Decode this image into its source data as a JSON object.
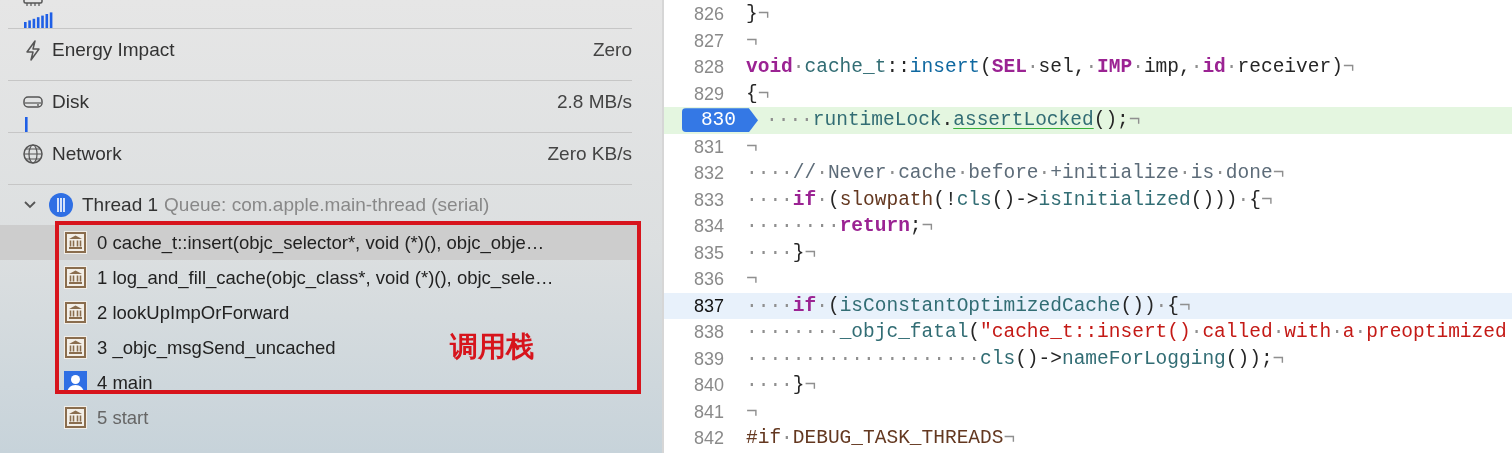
{
  "gauges": [
    {
      "kind": "memory",
      "graph": true
    },
    {
      "kind": "energy",
      "label": "Energy Impact",
      "value": "Zero"
    },
    {
      "kind": "disk",
      "label": "Disk",
      "value": "2.8 MB/s",
      "graph": true
    },
    {
      "kind": "network",
      "label": "Network",
      "value": "Zero KB/s"
    }
  ],
  "thread": {
    "expanded": true,
    "name": "Thread 1",
    "queue": "Queue: com.apple.main-thread (serial)"
  },
  "frames": [
    {
      "kind": "system",
      "text": "0 cache_t::insert(objc_selector*, void (*)(), objc_obje…",
      "selected": true,
      "dimmed": false
    },
    {
      "kind": "system",
      "text": "1 log_and_fill_cache(objc_class*, void (*)(), objc_sele…",
      "selected": false,
      "dimmed": false
    },
    {
      "kind": "system",
      "text": "2 lookUpImpOrForward",
      "selected": false,
      "dimmed": false
    },
    {
      "kind": "system",
      "text": "3 _objc_msgSend_uncached",
      "selected": false,
      "dimmed": false
    },
    {
      "kind": "user",
      "text": "4 main",
      "selected": false,
      "dimmed": false
    },
    {
      "kind": "system",
      "text": "5 start",
      "selected": false,
      "dimmed": true
    }
  ],
  "annotation": {
    "label": "调用栈"
  },
  "code_lines": [
    {
      "number": "826",
      "breakpoint": false,
      "executing": false,
      "current": false,
      "tokens": [
        {
          "kind": "plain",
          "text": "}"
        },
        {
          "kind": "ws",
          "text": "¬"
        }
      ]
    },
    {
      "number": "827",
      "breakpoint": false,
      "executing": false,
      "current": false,
      "tokens": [
        {
          "kind": "ws",
          "text": "¬"
        }
      ]
    },
    {
      "number": "828",
      "breakpoint": false,
      "executing": false,
      "current": false,
      "tokens": [
        {
          "kind": "keyword",
          "text": "void"
        },
        {
          "kind": "ws",
          "text": "·"
        },
        {
          "kind": "member",
          "text": "cache_t"
        },
        {
          "kind": "plain",
          "text": "::"
        },
        {
          "kind": "decl",
          "text": "insert"
        },
        {
          "kind": "plain",
          "text": "("
        },
        {
          "kind": "keyword",
          "text": "SEL"
        },
        {
          "kind": "ws",
          "text": "·"
        },
        {
          "kind": "plain",
          "text": "sel,"
        },
        {
          "kind": "ws",
          "text": "·"
        },
        {
          "kind": "keyword",
          "text": "IMP"
        },
        {
          "kind": "ws",
          "text": "·"
        },
        {
          "kind": "plain",
          "text": "imp,"
        },
        {
          "kind": "ws",
          "text": "·"
        },
        {
          "kind": "keyword",
          "text": "id"
        },
        {
          "kind": "ws",
          "text": "·"
        },
        {
          "kind": "plain",
          "text": "receiver)"
        },
        {
          "kind": "ws",
          "text": "¬"
        }
      ]
    },
    {
      "number": "829",
      "breakpoint": false,
      "executing": false,
      "current": false,
      "tokens": [
        {
          "kind": "plain",
          "text": "{"
        },
        {
          "kind": "ws",
          "text": "¬"
        }
      ]
    },
    {
      "number": "830",
      "breakpoint": true,
      "executing": true,
      "current": false,
      "tokens": [
        {
          "kind": "ws",
          "text": "····"
        },
        {
          "kind": "member",
          "text": "runtimeLock"
        },
        {
          "kind": "plain",
          "text": "."
        },
        {
          "kind": "link",
          "text": "assertLocked"
        },
        {
          "kind": "plain",
          "text": "();"
        },
        {
          "kind": "ws",
          "text": "¬"
        }
      ]
    },
    {
      "number": "831",
      "breakpoint": false,
      "executing": false,
      "current": false,
      "tokens": [
        {
          "kind": "ws",
          "text": "¬"
        }
      ]
    },
    {
      "number": "832",
      "breakpoint": false,
      "executing": false,
      "current": false,
      "tokens": [
        {
          "kind": "ws",
          "text": "····"
        },
        {
          "kind": "comment",
          "text": "//"
        },
        {
          "kind": "ws",
          "text": "·"
        },
        {
          "kind": "comment",
          "text": "Never"
        },
        {
          "kind": "ws",
          "text": "·"
        },
        {
          "kind": "comment",
          "text": "cache"
        },
        {
          "kind": "ws",
          "text": "·"
        },
        {
          "kind": "comment",
          "text": "before"
        },
        {
          "kind": "ws",
          "text": "·"
        },
        {
          "kind": "comment",
          "text": "+initialize"
        },
        {
          "kind": "ws",
          "text": "·"
        },
        {
          "kind": "comment",
          "text": "is"
        },
        {
          "kind": "ws",
          "text": "·"
        },
        {
          "kind": "comment",
          "text": "done"
        },
        {
          "kind": "ws",
          "text": "¬"
        }
      ]
    },
    {
      "number": "833",
      "breakpoint": false,
      "executing": false,
      "current": false,
      "tokens": [
        {
          "kind": "ws",
          "text": "····"
        },
        {
          "kind": "keyword",
          "text": "if"
        },
        {
          "kind": "ws",
          "text": "·"
        },
        {
          "kind": "plain",
          "text": "("
        },
        {
          "kind": "macro",
          "text": "slowpath"
        },
        {
          "kind": "plain",
          "text": "(!"
        },
        {
          "kind": "member",
          "text": "cls"
        },
        {
          "kind": "plain",
          "text": "()->"
        },
        {
          "kind": "member",
          "text": "isInitialized"
        },
        {
          "kind": "plain",
          "text": "()))"
        },
        {
          "kind": "ws",
          "text": "·"
        },
        {
          "kind": "plain",
          "text": "{"
        },
        {
          "kind": "ws",
          "text": "¬"
        }
      ]
    },
    {
      "number": "834",
      "breakpoint": false,
      "executing": false,
      "current": false,
      "tokens": [
        {
          "kind": "ws",
          "text": "········"
        },
        {
          "kind": "keyword",
          "text": "return"
        },
        {
          "kind": "plain",
          "text": ";"
        },
        {
          "kind": "ws",
          "text": "¬"
        }
      ]
    },
    {
      "number": "835",
      "breakpoint": false,
      "executing": false,
      "current": false,
      "tokens": [
        {
          "kind": "ws",
          "text": "····"
        },
        {
          "kind": "plain",
          "text": "}"
        },
        {
          "kind": "ws",
          "text": "¬"
        }
      ]
    },
    {
      "number": "836",
      "breakpoint": false,
      "executing": false,
      "current": false,
      "tokens": [
        {
          "kind": "ws",
          "text": "¬"
        }
      ]
    },
    {
      "number": "837",
      "breakpoint": false,
      "executing": false,
      "current": true,
      "tokens": [
        {
          "kind": "ws",
          "text": "····"
        },
        {
          "kind": "keyword",
          "text": "if"
        },
        {
          "kind": "ws",
          "text": "·"
        },
        {
          "kind": "plain",
          "text": "("
        },
        {
          "kind": "member",
          "text": "isConstantOptimizedCache"
        },
        {
          "kind": "plain",
          "text": "())"
        },
        {
          "kind": "ws",
          "text": "·"
        },
        {
          "kind": "plain",
          "text": "{"
        },
        {
          "kind": "ws",
          "text": "¬"
        }
      ]
    },
    {
      "number": "838",
      "breakpoint": false,
      "executing": false,
      "current": false,
      "tokens": [
        {
          "kind": "ws",
          "text": "········"
        },
        {
          "kind": "member",
          "text": "_objc_fatal"
        },
        {
          "kind": "plain",
          "text": "("
        },
        {
          "kind": "string",
          "text": "\"cache_t::insert()"
        },
        {
          "kind": "ws",
          "text": "·"
        },
        {
          "kind": "string",
          "text": "called"
        },
        {
          "kind": "ws",
          "text": "·"
        },
        {
          "kind": "string",
          "text": "with"
        },
        {
          "kind": "ws",
          "text": "·"
        },
        {
          "kind": "string",
          "text": "a"
        },
        {
          "kind": "ws",
          "text": "·"
        },
        {
          "kind": "string",
          "text": "preoptimized"
        }
      ]
    },
    {
      "number": "839",
      "breakpoint": false,
      "executing": false,
      "current": false,
      "tokens": [
        {
          "kind": "ws",
          "text": "····················"
        },
        {
          "kind": "member",
          "text": "cls"
        },
        {
          "kind": "plain",
          "text": "()->"
        },
        {
          "kind": "member",
          "text": "nameForLogging"
        },
        {
          "kind": "plain",
          "text": "());"
        },
        {
          "kind": "ws",
          "text": "¬"
        }
      ]
    },
    {
      "number": "840",
      "breakpoint": false,
      "executing": false,
      "current": false,
      "tokens": [
        {
          "kind": "ws",
          "text": "····"
        },
        {
          "kind": "plain",
          "text": "}"
        },
        {
          "kind": "ws",
          "text": "¬"
        }
      ]
    },
    {
      "number": "841",
      "breakpoint": false,
      "executing": false,
      "current": false,
      "tokens": [
        {
          "kind": "ws",
          "text": "¬"
        }
      ]
    },
    {
      "number": "842",
      "breakpoint": false,
      "executing": false,
      "current": false,
      "tokens": [
        {
          "kind": "preproc",
          "text": "#if"
        },
        {
          "kind": "ws",
          "text": "·"
        },
        {
          "kind": "preproc",
          "text": "DEBUG_TASK_THREADS"
        },
        {
          "kind": "ws",
          "text": "¬"
        }
      ]
    }
  ]
}
